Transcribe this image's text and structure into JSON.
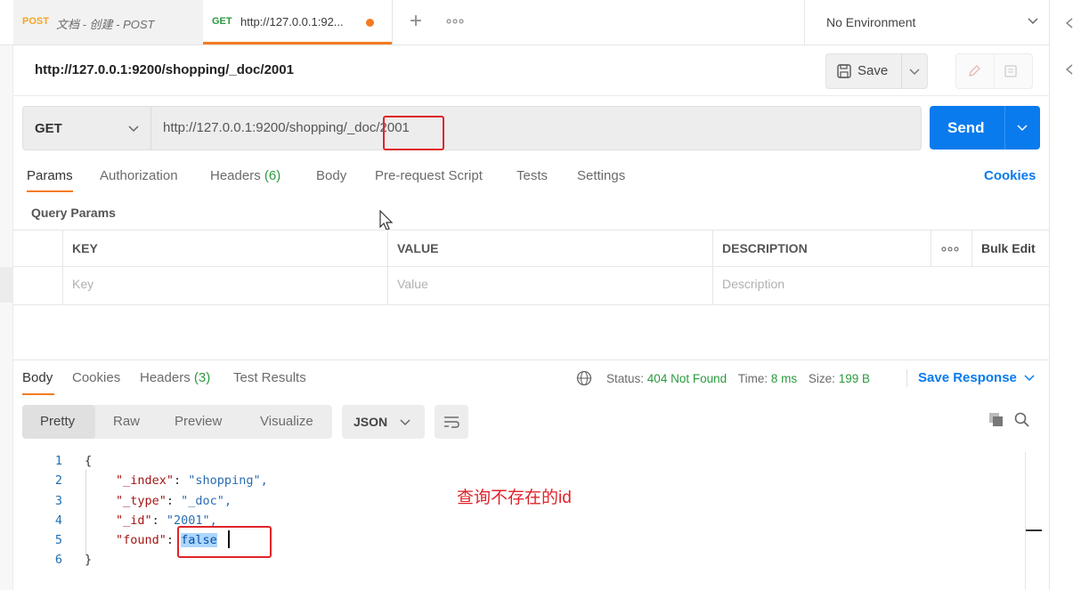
{
  "tabs": [
    {
      "method": "POST",
      "title": "文档 - 创建 - POST",
      "method_color": "#f5a623"
    },
    {
      "method": "GET",
      "title": "http://127.0.0.1:92...",
      "method_color": "#2b9a3f"
    }
  ],
  "environment": "No Environment",
  "request_title": "http://127.0.0.1:9200/shopping/_doc/2001",
  "save_label": "Save",
  "method": "GET",
  "url": "http://127.0.0.1:9200/shopping/_doc/2001",
  "send_label": "Send",
  "req_tabs": [
    {
      "label": "Params"
    },
    {
      "label": "Authorization"
    },
    {
      "label": "Headers",
      "count": "(6)"
    },
    {
      "label": "Body"
    },
    {
      "label": "Pre-request Script"
    },
    {
      "label": "Tests"
    },
    {
      "label": "Settings"
    }
  ],
  "cookies_link": "Cookies",
  "query_params_title": "Query Params",
  "params_table": {
    "headers": [
      "KEY",
      "VALUE",
      "DESCRIPTION"
    ],
    "bulk_edit": "Bulk Edit",
    "placeholders": [
      "Key",
      "Value",
      "Description"
    ]
  },
  "resp_tabs": [
    {
      "label": "Body"
    },
    {
      "label": "Cookies"
    },
    {
      "label": "Headers",
      "count": "(3)"
    },
    {
      "label": "Test Results"
    }
  ],
  "status": {
    "label": "Status:",
    "value": "404 Not Found",
    "time_label": "Time:",
    "time": "8 ms",
    "size_label": "Size:",
    "size": "199 B"
  },
  "save_response": "Save Response",
  "view_modes": [
    "Pretty",
    "Raw",
    "Preview",
    "Visualize"
  ],
  "format": "JSON",
  "code_lines": [
    {
      "n": "1",
      "text": "{"
    },
    {
      "n": "2",
      "key": "\"_index\"",
      "val": "\"shopping\","
    },
    {
      "n": "3",
      "key": "\"_type\"",
      "val": "\"_doc\","
    },
    {
      "n": "4",
      "key": "\"_id\"",
      "val": "\"2001\","
    },
    {
      "n": "5",
      "key": "\"found\"",
      "val": "false"
    },
    {
      "n": "6",
      "text": "}"
    }
  ],
  "annotation": "查询不存在的id",
  "colors": {
    "accent": "#097bed",
    "status_ok": "#2b9a3f",
    "annotation": "#e0242a"
  }
}
